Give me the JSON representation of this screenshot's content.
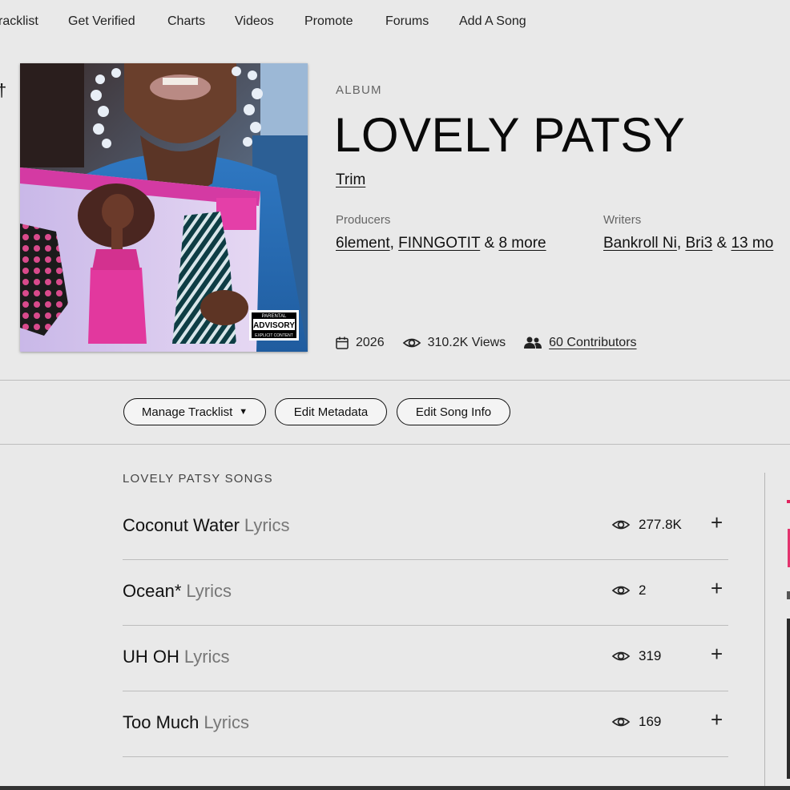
{
  "nav": {
    "items": [
      "racklist",
      "Get Verified",
      "Charts",
      "Videos",
      "Promote",
      "Forums",
      "Add A Song"
    ]
  },
  "album": {
    "kind_label": "ALBUM",
    "title": "LOVELY PATSY",
    "artist": "Trim",
    "producers_label": "Producers",
    "producers": [
      "6lement",
      "FINNGOTIT"
    ],
    "producers_more": "8 more",
    "writers_label": "Writers",
    "writers": [
      "Bankroll Ni",
      "Bri3"
    ],
    "writers_more": "13 mo",
    "year": "2026",
    "views": "310.2K Views",
    "contributors": "60 Contributors",
    "cover_badge_lines": [
      "PARENTAL",
      "ADVISORY",
      "EXPLICIT CONTENT"
    ]
  },
  "actions": {
    "manage_tracklist": "Manage Tracklist",
    "edit_metadata": "Edit Metadata",
    "edit_song_info": "Edit Song Info"
  },
  "songs": {
    "heading": "LOVELY PATSY SONGS",
    "lyrics_suffix": "Lyrics",
    "items": [
      {
        "title": "Coconut Water",
        "views": "277.8K"
      },
      {
        "title": "Ocean*",
        "views": "2"
      },
      {
        "title": "UH OH",
        "views": "319"
      },
      {
        "title": "Too Much",
        "views": "169"
      }
    ]
  },
  "icons": {
    "calendar": "calendar-icon",
    "views": "eye-icon",
    "contributors": "people-icon",
    "add": "plus-icon",
    "dropdown": "caret-down-icon"
  },
  "colors": {
    "background": "#e9e9e9",
    "text": "#111111",
    "muted": "#777777",
    "divider": "#bdbdbd"
  }
}
